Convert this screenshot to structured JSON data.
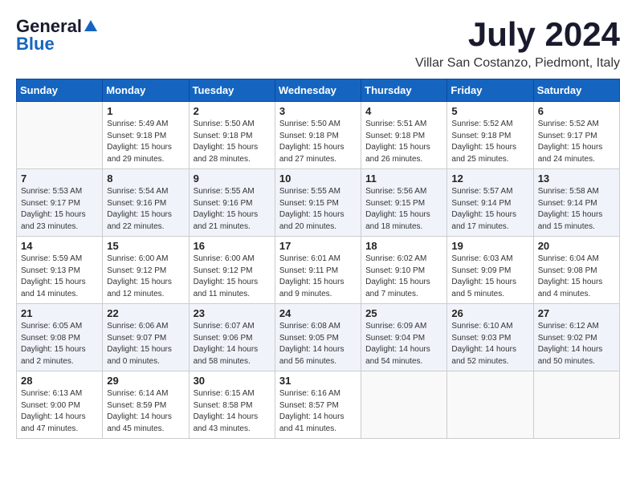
{
  "header": {
    "logo_general": "General",
    "logo_blue": "Blue",
    "month_year": "July 2024",
    "location": "Villar San Costanzo, Piedmont, Italy"
  },
  "weekdays": [
    "Sunday",
    "Monday",
    "Tuesday",
    "Wednesday",
    "Thursday",
    "Friday",
    "Saturday"
  ],
  "weeks": [
    [
      {
        "num": "",
        "info": ""
      },
      {
        "num": "1",
        "info": "Sunrise: 5:49 AM\nSunset: 9:18 PM\nDaylight: 15 hours\nand 29 minutes."
      },
      {
        "num": "2",
        "info": "Sunrise: 5:50 AM\nSunset: 9:18 PM\nDaylight: 15 hours\nand 28 minutes."
      },
      {
        "num": "3",
        "info": "Sunrise: 5:50 AM\nSunset: 9:18 PM\nDaylight: 15 hours\nand 27 minutes."
      },
      {
        "num": "4",
        "info": "Sunrise: 5:51 AM\nSunset: 9:18 PM\nDaylight: 15 hours\nand 26 minutes."
      },
      {
        "num": "5",
        "info": "Sunrise: 5:52 AM\nSunset: 9:18 PM\nDaylight: 15 hours\nand 25 minutes."
      },
      {
        "num": "6",
        "info": "Sunrise: 5:52 AM\nSunset: 9:17 PM\nDaylight: 15 hours\nand 24 minutes."
      }
    ],
    [
      {
        "num": "7",
        "info": "Sunrise: 5:53 AM\nSunset: 9:17 PM\nDaylight: 15 hours\nand 23 minutes."
      },
      {
        "num": "8",
        "info": "Sunrise: 5:54 AM\nSunset: 9:16 PM\nDaylight: 15 hours\nand 22 minutes."
      },
      {
        "num": "9",
        "info": "Sunrise: 5:55 AM\nSunset: 9:16 PM\nDaylight: 15 hours\nand 21 minutes."
      },
      {
        "num": "10",
        "info": "Sunrise: 5:55 AM\nSunset: 9:15 PM\nDaylight: 15 hours\nand 20 minutes."
      },
      {
        "num": "11",
        "info": "Sunrise: 5:56 AM\nSunset: 9:15 PM\nDaylight: 15 hours\nand 18 minutes."
      },
      {
        "num": "12",
        "info": "Sunrise: 5:57 AM\nSunset: 9:14 PM\nDaylight: 15 hours\nand 17 minutes."
      },
      {
        "num": "13",
        "info": "Sunrise: 5:58 AM\nSunset: 9:14 PM\nDaylight: 15 hours\nand 15 minutes."
      }
    ],
    [
      {
        "num": "14",
        "info": "Sunrise: 5:59 AM\nSunset: 9:13 PM\nDaylight: 15 hours\nand 14 minutes."
      },
      {
        "num": "15",
        "info": "Sunrise: 6:00 AM\nSunset: 9:12 PM\nDaylight: 15 hours\nand 12 minutes."
      },
      {
        "num": "16",
        "info": "Sunrise: 6:00 AM\nSunset: 9:12 PM\nDaylight: 15 hours\nand 11 minutes."
      },
      {
        "num": "17",
        "info": "Sunrise: 6:01 AM\nSunset: 9:11 PM\nDaylight: 15 hours\nand 9 minutes."
      },
      {
        "num": "18",
        "info": "Sunrise: 6:02 AM\nSunset: 9:10 PM\nDaylight: 15 hours\nand 7 minutes."
      },
      {
        "num": "19",
        "info": "Sunrise: 6:03 AM\nSunset: 9:09 PM\nDaylight: 15 hours\nand 5 minutes."
      },
      {
        "num": "20",
        "info": "Sunrise: 6:04 AM\nSunset: 9:08 PM\nDaylight: 15 hours\nand 4 minutes."
      }
    ],
    [
      {
        "num": "21",
        "info": "Sunrise: 6:05 AM\nSunset: 9:08 PM\nDaylight: 15 hours\nand 2 minutes."
      },
      {
        "num": "22",
        "info": "Sunrise: 6:06 AM\nSunset: 9:07 PM\nDaylight: 15 hours\nand 0 minutes."
      },
      {
        "num": "23",
        "info": "Sunrise: 6:07 AM\nSunset: 9:06 PM\nDaylight: 14 hours\nand 58 minutes."
      },
      {
        "num": "24",
        "info": "Sunrise: 6:08 AM\nSunset: 9:05 PM\nDaylight: 14 hours\nand 56 minutes."
      },
      {
        "num": "25",
        "info": "Sunrise: 6:09 AM\nSunset: 9:04 PM\nDaylight: 14 hours\nand 54 minutes."
      },
      {
        "num": "26",
        "info": "Sunrise: 6:10 AM\nSunset: 9:03 PM\nDaylight: 14 hours\nand 52 minutes."
      },
      {
        "num": "27",
        "info": "Sunrise: 6:12 AM\nSunset: 9:02 PM\nDaylight: 14 hours\nand 50 minutes."
      }
    ],
    [
      {
        "num": "28",
        "info": "Sunrise: 6:13 AM\nSunset: 9:00 PM\nDaylight: 14 hours\nand 47 minutes."
      },
      {
        "num": "29",
        "info": "Sunrise: 6:14 AM\nSunset: 8:59 PM\nDaylight: 14 hours\nand 45 minutes."
      },
      {
        "num": "30",
        "info": "Sunrise: 6:15 AM\nSunset: 8:58 PM\nDaylight: 14 hours\nand 43 minutes."
      },
      {
        "num": "31",
        "info": "Sunrise: 6:16 AM\nSunset: 8:57 PM\nDaylight: 14 hours\nand 41 minutes."
      },
      {
        "num": "",
        "info": ""
      },
      {
        "num": "",
        "info": ""
      },
      {
        "num": "",
        "info": ""
      }
    ]
  ]
}
